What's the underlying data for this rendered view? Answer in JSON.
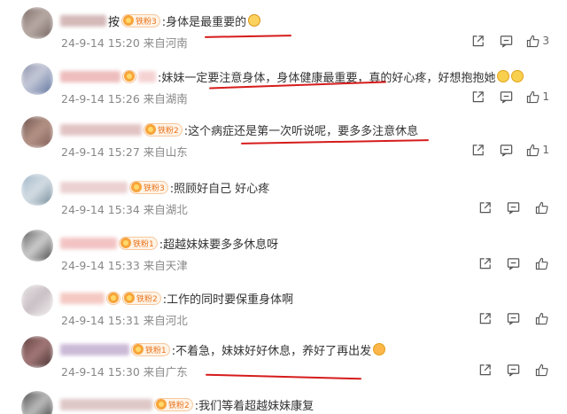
{
  "comments": [
    {
      "name_color": "#c7a1a1",
      "badge": "铁粉3",
      "text": ":身体是最重要的",
      "time": "24-9-14 15:20",
      "location": "来自河南",
      "likes": "3",
      "emoji": "crying-emoji"
    },
    {
      "name_color": "#e9a7a7",
      "badge": "",
      "text": ":妹妹一定要注意身体，身体健康最重要，真的好心疼，好想抱抱她",
      "time": "24-9-14 15:26",
      "location": "来自湖南",
      "likes": "1",
      "emoji": "hug-emoji"
    },
    {
      "name_color": "#d9b0b0",
      "badge": "铁粉2",
      "text": ":这个病症还是第一次听说呢，要多多注意休息",
      "time": "24-9-14 15:27",
      "location": "来自山东",
      "likes": "1",
      "emoji": ""
    },
    {
      "name_color": "#e6c2c2",
      "badge": "铁粉3",
      "text": ":照顾好自己 好心疼",
      "time": "24-9-14 15:34",
      "location": "来自湖北",
      "likes": "",
      "emoji": ""
    },
    {
      "name_color": "#efb0b0",
      "badge": "铁粉1",
      "text": ":超越妹妹要多多休息呀",
      "time": "24-9-14 15:33",
      "location": "来自天津",
      "likes": "",
      "emoji": ""
    },
    {
      "name_color": "#f1b8b0",
      "badge": "铁粉2",
      "text": ":工作的同时要保重身体啊",
      "time": "24-9-14 15:31",
      "location": "来自河北",
      "likes": "",
      "emoji": ""
    },
    {
      "name_color": "#b9a3c9",
      "badge": "铁粉1",
      "text": ":不着急，妹妹好好休息，养好了再出发",
      "time": "24-9-14 15:30",
      "location": "来自广东",
      "likes": "",
      "emoji": "smile-emoji"
    },
    {
      "name_color": "#d3b5b5",
      "badge": "铁粉2",
      "text": ":我们等着超越妹妹康复",
      "time": "",
      "location": "",
      "likes": "",
      "emoji": ""
    }
  ],
  "icons": {
    "share": "share-icon",
    "comment": "comment-icon",
    "like": "thumbs-up-icon"
  },
  "colors": {
    "underline": "#d61c1c",
    "meta_text": "#888888",
    "badge_text": "#e8731d"
  }
}
